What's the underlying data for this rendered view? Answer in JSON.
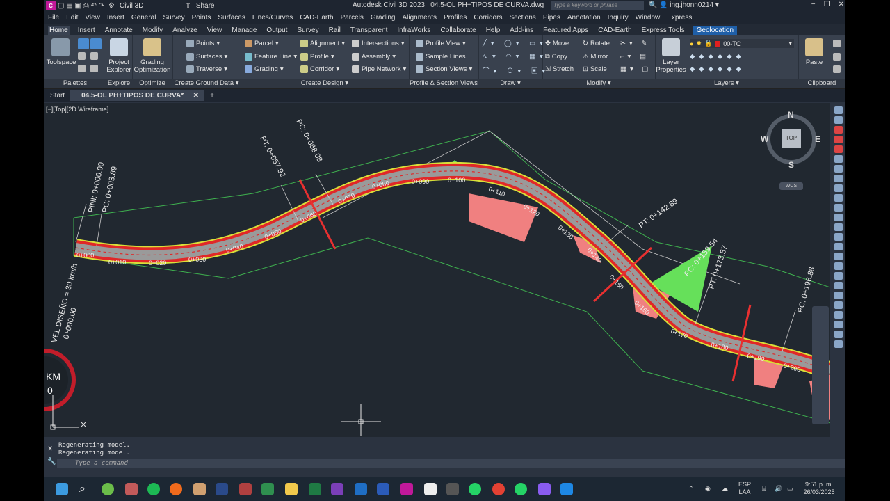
{
  "window": {
    "app_title": "Autodesk Civil 3D 2023",
    "file_title": "04.5-OL PH+TIPOS DE CURVA.dwg",
    "workspace": "Civil 3D",
    "share": "Share",
    "search_placeholder": "Type a keyword or phrase",
    "user": "ing.jhonn0214"
  },
  "menu": [
    "File",
    "Edit",
    "View",
    "Insert",
    "General",
    "Survey",
    "Points",
    "Surfaces",
    "Lines/Curves",
    "CAD-Earth",
    "Parcels",
    "Grading",
    "Alignments",
    "Profiles",
    "Corridors",
    "Sections",
    "Pipes",
    "Annotation",
    "Inquiry",
    "Window",
    "Express"
  ],
  "ribbon_tabs": [
    "Home",
    "Insert",
    "Annotate",
    "Modify",
    "Analyze",
    "View",
    "Manage",
    "Output",
    "Survey",
    "Rail",
    "Transparent",
    "InfraWorks",
    "Collaborate",
    "Help",
    "Add-ins",
    "Featured Apps",
    "CAD-Earth",
    "Express Tools",
    "Geolocation"
  ],
  "ribbon": {
    "toolspace": "Toolspace",
    "project_explorer": [
      "Project",
      "Explorer"
    ],
    "grading_optimization": [
      "Grading",
      "Optimization"
    ],
    "points": "Points",
    "surfaces": "Surfaces",
    "traverse": "Traverse",
    "parcel": "Parcel",
    "feature_line": "Feature Line",
    "grading": "Grading",
    "alignment": "Alignment",
    "profile": "Profile",
    "corridor": "Corridor",
    "intersections": "Intersections",
    "assembly": "Assembly",
    "pipe_network": "Pipe Network",
    "profile_view": "Profile View",
    "sample_lines": "Sample Lines",
    "section_views": "Section Views",
    "move": "Move",
    "copy": "Copy",
    "stretch": "Stretch",
    "rotate": "Rotate",
    "mirror": "Mirror",
    "scale": "Scale",
    "layer_properties": [
      "Layer",
      "Properties"
    ],
    "layer_name": "00-TC",
    "paste": "Paste",
    "panels": [
      "Palettes",
      "Explore",
      "Optimize",
      "Create Ground Data",
      "Create Design",
      "Profile & Section Views",
      "Draw",
      "Modify",
      "Layers",
      "Clipboard"
    ]
  },
  "doc_tabs": {
    "start": "Start",
    "current": "04.5-OL PH+TIPOS DE CURVA*"
  },
  "viewport": {
    "label": "[−][Top][2D Wireframe]",
    "compass": {
      "n": "N",
      "s": "S",
      "e": "E",
      "w": "W",
      "top": "TOP",
      "wcs": "WCS"
    },
    "km_label": [
      "KM",
      "0"
    ],
    "design_speed": "VEL DISEÑO = 30 km/h",
    "station_start": "0+000.00",
    "labels": [
      {
        "text": "PINI: 0+000.00"
      },
      {
        "text": "PC: 0+003.89"
      },
      {
        "text": "PT: 0+057.92"
      },
      {
        "text": "PC: 0+068.08"
      },
      {
        "text": "PT: 0+142.89"
      },
      {
        "text": "PC: 0+159.54"
      },
      {
        "text": "PT: 0+173.57"
      },
      {
        "text": "PC: 0+196.88"
      }
    ],
    "stations": [
      "0+000",
      "0+010",
      "0+020",
      "0+030",
      "0+040",
      "0+050",
      "0+060",
      "0+070",
      "0+080",
      "0+090",
      "0+100",
      "0+110",
      "0+120",
      "0+130",
      "0+140",
      "0+150",
      "0+160",
      "0+170",
      "0+180",
      "0+190",
      "0+200"
    ]
  },
  "command": {
    "history": [
      "Regenerating model.",
      "Regenerating model."
    ],
    "placeholder": "Type a command"
  },
  "taskbar": {
    "lang": [
      "ESP",
      "LAA"
    ],
    "time": "9:51 p. m.",
    "date": "26/03/2025"
  }
}
